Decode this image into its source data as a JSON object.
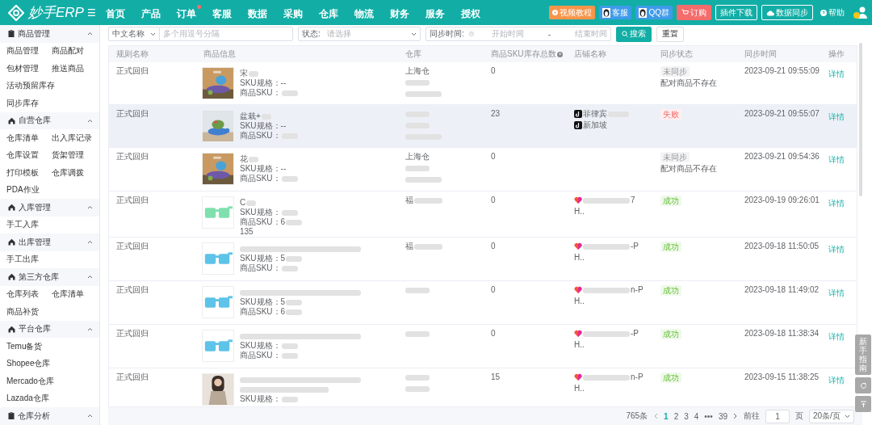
{
  "header": {
    "logo": "妙手ERP",
    "menu_glyph": "☰",
    "nav": [
      {
        "label": "首页",
        "badge": false
      },
      {
        "label": "产品",
        "badge": false
      },
      {
        "label": "订单",
        "badge": true
      },
      {
        "label": "客服",
        "badge": false
      },
      {
        "label": "数据",
        "badge": false
      },
      {
        "label": "采购",
        "badge": false
      },
      {
        "label": "仓库",
        "badge": false
      },
      {
        "label": "物流",
        "badge": false
      },
      {
        "label": "财务",
        "badge": false
      },
      {
        "label": "服务",
        "badge": false
      },
      {
        "label": "授权",
        "badge": false
      }
    ],
    "actions": [
      {
        "kind": "video",
        "label": "视频教程"
      },
      {
        "kind": "qq",
        "label": "客服"
      },
      {
        "kind": "group",
        "label": "QQ群"
      },
      {
        "kind": "order",
        "label": "订购"
      },
      {
        "kind": "outline",
        "label": "插件下载"
      },
      {
        "kind": "cloud",
        "label": "数据同步"
      },
      {
        "kind": "help",
        "label": "帮助"
      }
    ]
  },
  "sidebar": [
    {
      "title": "商品管理",
      "expanded": true,
      "items": [
        "商品管理",
        "商品配对",
        "包材管理",
        "推送商品",
        "活动预留库存",
        "同步库存"
      ]
    },
    {
      "title": "自营仓库",
      "expanded": true,
      "items": [
        "仓库清单",
        "出入库记录",
        "仓库设置",
        "货架管理",
        "打印模板",
        "仓库调拨",
        "PDA作业"
      ]
    },
    {
      "title": "入库管理",
      "expanded": true,
      "items": [
        "手工入库"
      ]
    },
    {
      "title": "出库管理",
      "expanded": true,
      "items": [
        "手工出库"
      ]
    },
    {
      "title": "第三方仓库",
      "expanded": true,
      "items": [
        "仓库列表",
        "仓库清单",
        "商品补货"
      ]
    },
    {
      "title": "平台仓库",
      "expanded": true,
      "items": [
        "Temu备货",
        "Shopee仓库",
        "Mercado仓库",
        "Lazada仓库"
      ]
    },
    {
      "title": "仓库分析",
      "expanded": true
    }
  ],
  "filters": {
    "field_select": "中文名称",
    "keyword": {
      "placeholder": "多个用逗号分隔"
    },
    "status_label": "状态:",
    "status": {
      "placeholder": "请选择"
    },
    "time_label": "同步时间:",
    "start": {
      "placeholder": "开始时间"
    },
    "range_separator": "-",
    "end": {
      "placeholder": "结束时间"
    },
    "search": "搜索",
    "reset": "重置"
  },
  "table": {
    "columns": [
      "规则名称",
      "商品信息",
      "仓库",
      "商品SKU库存总数",
      "店铺名称",
      "同步状态",
      "同步时间",
      "操作"
    ],
    "rows": [
      {
        "selected": false,
        "rule": "正式回归",
        "product": [
          {
            "text": "宋",
            "redacted": true
          },
          {
            "text": "SKU规格：--",
            "redacted": false
          },
          {
            "text": "商品SKU：",
            "redacted": true
          }
        ],
        "warehouse": [
          {
            "text": "上海仓",
            "redacted": false
          },
          {
            "redacted": true
          },
          {
            "redacted": true
          }
        ],
        "stock": "0",
        "shops": [],
        "status": {
          "kind": "pending",
          "label": "未同步"
        },
        "note": "配对商品不存在",
        "time": "2023-09-21 09:55:09",
        "action": "详情"
      },
      {
        "selected": true,
        "rule": "正式回归",
        "product": [
          {
            "text": "盆栽+",
            "redacted": true
          },
          {
            "text": "SKU规格：--",
            "redacted": false
          },
          {
            "text": "商品SKU：",
            "redacted": true
          }
        ],
        "warehouse": [
          {
            "redacted": true
          },
          {
            "redacted": true
          },
          {
            "redacted": true
          }
        ],
        "stock": "23",
        "shops": [
          {
            "kind": "tiktok",
            "text": "菲律宾",
            "redacted": true
          },
          {
            "kind": "tiktok",
            "text": "新加坡",
            "redacted": false
          }
        ],
        "status": {
          "kind": "failed",
          "label": "失败"
        },
        "time": "2023-09-21 09:55:07",
        "action": "详情"
      },
      {
        "selected": false,
        "rule": "正式回归",
        "product": [
          {
            "text": "花",
            "redacted": true
          },
          {
            "text": "SKU规格：--",
            "redacted": false
          },
          {
            "text": "商品SKU：",
            "redacted": true
          }
        ],
        "warehouse": [
          {
            "text": "上海仓",
            "redacted": false
          },
          {
            "redacted": true
          },
          {
            "redacted": true
          }
        ],
        "stock": "0",
        "shops": [],
        "status": {
          "kind": "pending",
          "label": "未同步"
        },
        "note": "配对商品不存在",
        "time": "2023-09-21 09:54:36",
        "action": "详情"
      },
      {
        "selected": false,
        "rule": "正式回归",
        "product": [
          {
            "text": "C",
            "redacted": true
          },
          {
            "text": "SKU规格：",
            "redacted": true
          },
          {
            "text": "商品SKU：6",
            "redacted": true
          },
          {
            "text": "135",
            "redacted": false
          }
        ],
        "warehouse": [
          {
            "text": "福",
            "redacted": true
          }
        ],
        "stock": "0",
        "shops": [
          {
            "kind": "lazada",
            "text": "7",
            "redacted": true
          },
          {
            "kind": "plain",
            "text": "H..",
            "redacted": false
          }
        ],
        "status": {
          "kind": "success",
          "label": "成功"
        },
        "time": "2023-09-19 09:26:01",
        "action": "详情"
      },
      {
        "selected": false,
        "rule": "正式回归",
        "product": [
          {
            "redacted": true
          },
          {
            "text": "SKU规格：5",
            "redacted": true
          },
          {
            "text": "商品SKU：",
            "redacted": true
          }
        ],
        "warehouse": [
          {
            "text": "福",
            "redacted": true
          }
        ],
        "stock": "0",
        "shops": [
          {
            "kind": "lazada",
            "text": "-P",
            "redacted": true
          },
          {
            "kind": "plain",
            "text": "H..",
            "redacted": false
          }
        ],
        "status": {
          "kind": "success",
          "label": "成功"
        },
        "time": "2023-09-18 11:50:05",
        "action": "详情"
      },
      {
        "selected": false,
        "rule": "正式回归",
        "product": [
          {
            "redacted": true
          },
          {
            "text": "SKU规格：5",
            "redacted": true
          },
          {
            "text": "商品SKU：6",
            "redacted": true
          }
        ],
        "warehouse": [
          {
            "redacted": true
          }
        ],
        "stock": "0",
        "shops": [
          {
            "kind": "lazada",
            "text": "n-P",
            "redacted": true
          },
          {
            "kind": "plain",
            "text": "H..",
            "redacted": false
          }
        ],
        "status": {
          "kind": "success",
          "label": "成功"
        },
        "time": "2023-09-18 11:49:02",
        "action": "详情"
      },
      {
        "selected": false,
        "rule": "正式回归",
        "product": [
          {
            "redacted": true
          },
          {
            "text": "SKU规格：",
            "redacted": true
          },
          {
            "text": "商品SKU：",
            "redacted": true
          }
        ],
        "warehouse": [
          {
            "redacted": true
          }
        ],
        "stock": "0",
        "shops": [
          {
            "kind": "lazada",
            "text": "-P",
            "redacted": true
          },
          {
            "kind": "plain",
            "text": "H..",
            "redacted": false
          }
        ],
        "status": {
          "kind": "success",
          "label": "成功"
        },
        "time": "2023-09-18 11:38:34",
        "action": "详情"
      },
      {
        "selected": false,
        "rule": "正式回归",
        "product": [
          {
            "redacted": true
          },
          {
            "redacted": true
          },
          {
            "text": "SKU规格：",
            "redacted": true
          }
        ],
        "warehouse": [
          {
            "redacted": true
          },
          {
            "redacted": true
          }
        ],
        "stock": "15",
        "shops": [
          {
            "kind": "lazada",
            "text": "n-P",
            "redacted": true
          },
          {
            "kind": "plain",
            "text": "H..",
            "redacted": false
          }
        ],
        "status": {
          "kind": "success",
          "label": "成功"
        },
        "time": "2023-09-15 11:38:25",
        "action": "详情"
      }
    ]
  },
  "pagination": {
    "total": "765条",
    "pages": [
      {
        "label": "1",
        "selected": true
      },
      {
        "label": "2",
        "selected": false
      },
      {
        "label": "3",
        "selected": false
      },
      {
        "label": "4",
        "selected": false
      }
    ],
    "ellipsis": "•••",
    "last": "39",
    "goto_label": "前往",
    "goto_value": "1",
    "page_suffix": "页",
    "page_size": "20条/页"
  },
  "float_tools": {
    "guide": "新手指南"
  }
}
